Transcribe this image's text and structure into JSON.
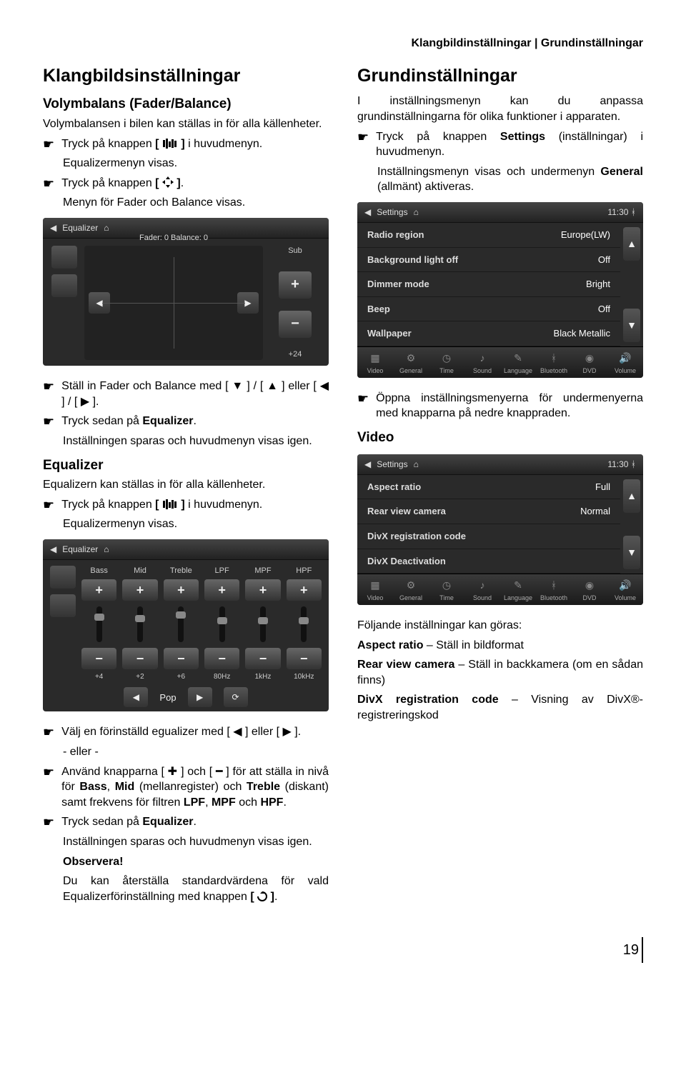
{
  "header": {
    "breadcrumb": "Klangbildinställningar | Grundinställningar"
  },
  "left": {
    "h1": "Klangbildsinställningar",
    "volym_h2": "Volymbalans (Fader/Balance)",
    "volym_intro": "Volymbalansen i bilen kan ställas in för alla källenheter.",
    "step1_a": "Tryck på knappen ",
    "step1_b": " i huvudmenyn.",
    "step1_after": "Equalizermenyn visas.",
    "step2_a": "Tryck på knappen ",
    "step2_b": ".",
    "step2_after": "Menyn för Fader och Balance visas.",
    "fader_screen": {
      "title": "Equalizer",
      "caption": "Fader: 0 Balance: 0",
      "sub_label": "Sub",
      "sub_val": "+24"
    },
    "step3": "Ställ in Fader och Balance med [ ▼ ] / [ ▲ ] eller [ ◀ ] / [ ▶ ].",
    "step4_a": "Tryck sedan på ",
    "step4_b": "Equalizer",
    "step4_c": ".",
    "step4_after": "Inställningen sparas och huvudmenyn visas igen.",
    "eq_h2": "Equalizer",
    "eq_intro": "Equalizern kan ställas in för alla källenheter.",
    "eq_step1_a": "Tryck på knappen ",
    "eq_step1_b": " i huvudmenyn.",
    "eq_step1_after": "Equalizermenyn visas.",
    "eq_screen": {
      "title": "Equalizer",
      "cols": [
        {
          "label": "Bass",
          "val": "+4",
          "thumb": 60
        },
        {
          "label": "Mid",
          "val": "+2",
          "thumb": 55
        },
        {
          "label": "Treble",
          "val": "+6",
          "thumb": 65
        },
        {
          "label": "LPF",
          "val": "80Hz",
          "thumb": 50
        },
        {
          "label": "MPF",
          "val": "1kHz",
          "thumb": 50
        },
        {
          "label": "HPF",
          "val": "10kHz",
          "thumb": 50
        }
      ],
      "preset": "Pop"
    },
    "eq_step2": "Välj en förinställd egualizer med [ ◀ ] eller [ ▶ ].",
    "eq_or": "- eller -",
    "eq_step3_a": "Använd knapparna [ ✚ ] och [ ━ ] för att ställa in nivå för ",
    "eq_step3_bass": "Bass",
    "eq_step3_mid_a": ", ",
    "eq_step3_mid": "Mid",
    "eq_step3_mid_b": " (mellanregister) och ",
    "eq_step3_treble": "Treble",
    "eq_step3_c": " (diskant) samt frekvens för filtren ",
    "eq_step3_lpf": "LPF",
    "eq_step3_d": ", ",
    "eq_step3_mpf": "MPF",
    "eq_step3_e": " och ",
    "eq_step3_hpf": "HPF",
    "eq_step3_f": ".",
    "eq_step4_a": "Tryck sedan på ",
    "eq_step4_b": "Equalizer",
    "eq_step4_c": ".",
    "eq_step4_after": "Inställningen sparas och huvudmenyn visas igen.",
    "obs_h": "Observera!",
    "obs_a": "Du kan återställa standardvärdena för vald Equalizerförinställning med knappen ",
    "obs_b": "."
  },
  "right": {
    "h1": "Grundinställningar",
    "intro": "I inställningsmenyn kan du anpassa grundinställningarna för olika funktioner i apparaten.",
    "step1_a": "Tryck på knappen ",
    "step1_b": "Settings",
    "step1_c": " (inställningar) i huvudmenyn.",
    "step1_after_a": "Inställningsmenyn visas och undermenyn ",
    "step1_after_b": "General",
    "step1_after_c": " (allmänt) aktiveras.",
    "settings_screen": {
      "title": "Settings",
      "time": "11:30",
      "rows": [
        {
          "label": "Radio region",
          "value": "Europe(LW)"
        },
        {
          "label": "Background light off",
          "value": "Off"
        },
        {
          "label": "Dimmer mode",
          "value": "Bright"
        },
        {
          "label": "Beep",
          "value": "Off"
        },
        {
          "label": "Wallpaper",
          "value": "Black Metallic"
        }
      ],
      "tabs": [
        "Video",
        "General",
        "Time",
        "Sound",
        "Language",
        "Bluetooth",
        "DVD",
        "Volume"
      ]
    },
    "step2": "Öppna inställningsmenyerna för undermenyerna med knapparna på nedre knappraden.",
    "video_h2": "Video",
    "video_screen": {
      "title": "Settings",
      "time": "11:30",
      "rows": [
        {
          "label": "Aspect ratio",
          "value": "Full"
        },
        {
          "label": "Rear view camera",
          "value": "Normal"
        },
        {
          "label": "DivX registration code",
          "value": ""
        },
        {
          "label": "DivX Deactivation",
          "value": ""
        }
      ],
      "tabs": [
        "Video",
        "General",
        "Time",
        "Sound",
        "Language",
        "Bluetooth",
        "DVD",
        "Volume"
      ]
    },
    "video_intro": "Följande inställningar kan göras:",
    "video_aspect_a": "Aspect ratio",
    "video_aspect_b": " – Ställ in bildformat",
    "video_rear_a": "Rear view camera",
    "video_rear_b": " – Ställ in backkamera (om en sådan finns)",
    "video_divx_a": "DivX registration code",
    "video_divx_b": " – Visning av DivX®-registreringskod"
  },
  "page": "19"
}
